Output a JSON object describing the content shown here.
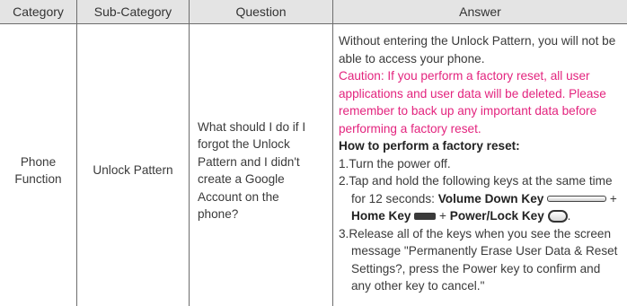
{
  "headers": {
    "category": "Category",
    "sub_category": "Sub-Category",
    "question": "Question",
    "answer": "Answer"
  },
  "row": {
    "category_line1": "Phone",
    "category_line2": "Function",
    "sub_category": "Unlock Pattern",
    "question": "What should I do if I forgot the Unlock Pattern and I didn't create a Google Account on the phone?",
    "answer": {
      "intro": "Without entering the Unlock Pattern, you will not be able to access your phone.",
      "caution": "Caution: If you perform a factory reset, all user applications and user data will be deleted. Please remember to back up any important data before performing a factory reset.",
      "howto_heading": "How to perform a factory reset:",
      "step1": "1.Turn the power off.",
      "step2_part1": "2.Tap and hold the following keys at the same time for 12 seconds: ",
      "volume_key": "Volume Down Key",
      "plus1": " + ",
      "home_key": "Home Key",
      "plus2": " + ",
      "power_key": "Power/Lock Key",
      "period": ".",
      "step3": "3.Release all of the keys when you see the screen message \"Permanently Erase User Data & Reset Settings?, press the Power key to confirm and any other key to cancel.\""
    }
  }
}
